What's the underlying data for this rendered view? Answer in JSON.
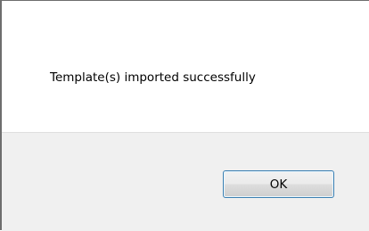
{
  "dialog": {
    "message": "Template(s) imported successfully",
    "ok_label": "OK"
  }
}
